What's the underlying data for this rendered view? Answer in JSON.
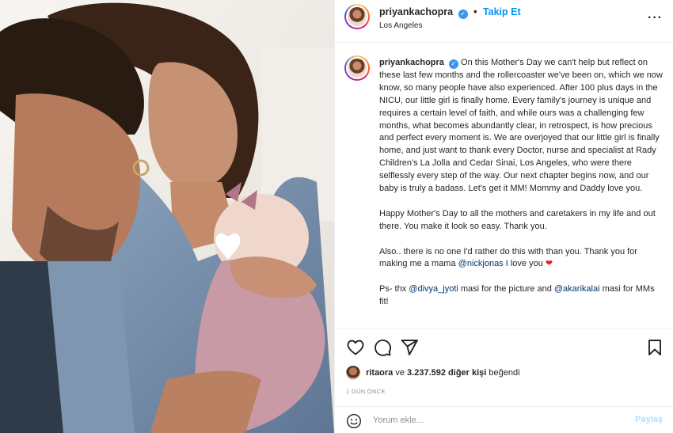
{
  "post": {
    "username": "priyankachopra",
    "verified_icon": "verified-badge-icon",
    "follow_label": "Takip Et",
    "location": "Los Angeles",
    "more_icon": "more-options-icon"
  },
  "caption": {
    "username": "priyankachopra",
    "paragraph1": "On this Mother's Day we can't help but reflect on these last few months and the rollercoaster we've been on, which we now know, so many people have also experienced. After 100 plus days in the NICU, our little girl is finally home. Every family's journey is unique and requires a certain level of faith, and while ours was a challenging few months, what becomes abundantly clear, in retrospect, is how precious and perfect every moment is. We are overjoyed that our little girl is finally home, and just want to thank every Doctor, nurse and specialist at Rady Children's La Jolla and Cedar Sinai, Los Angeles, who were there selflessly every step of the way. Our next chapter begins now, and our baby is truly a badass. Let's get it MM! Mommy and Daddy love you.",
    "paragraph2": "Happy Mother's Day to all the mothers and caretakers in my life and out there. You make it look so easy. Thank you.",
    "paragraph3_a": "Also.. there is no one I'd rather do this with than you. Thank you for making me a mama ",
    "mention_nick": "@nickjonas",
    "paragraph3_b": " I love you ",
    "heart": "❤",
    "paragraph4_a": "Ps- thx ",
    "mention_divya": "@divya_jyoti",
    "paragraph4_b": " masi for the picture and ",
    "mention_akari": "@akarikalai",
    "paragraph4_c": " masi for MMs fit!"
  },
  "actions": {
    "like_icon": "heart-icon",
    "comment_icon": "comment-icon",
    "share_icon": "share-icon",
    "save_icon": "bookmark-icon"
  },
  "likes": {
    "user": "ritaora",
    "connector": " ve ",
    "count": "3.237.592 diğer kişi",
    "suffix": " beğendi"
  },
  "time_ago": "1 GÜN ÖNCE",
  "comment": {
    "placeholder": "Yorum ekle...",
    "post_label": "Paylaş",
    "emoji_icon": "smiley-icon"
  },
  "colors": {
    "follow_blue": "#0095f6",
    "mention": "#00376b",
    "verified": "#3897f0",
    "heart_red": "#ed1c24",
    "muted": "#8e8e8e"
  }
}
